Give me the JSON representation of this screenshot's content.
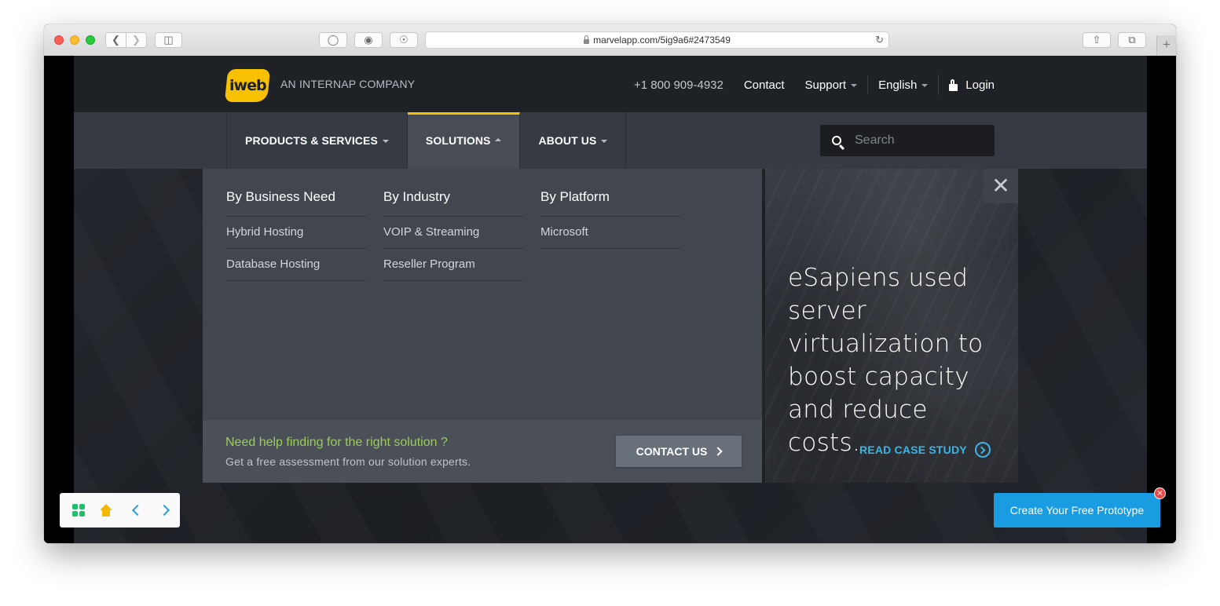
{
  "browser": {
    "url": "marvelapp.com/5ig9a6#2473549"
  },
  "header": {
    "logo_text": "iweb",
    "tagline": "AN INTERNAP COMPANY",
    "phone": "+1 800 909-4932",
    "contact": "Contact",
    "support": "Support",
    "language": "English",
    "login": "Login"
  },
  "nav": {
    "tabs": [
      {
        "label": "PRODUCTS & SERVICES"
      },
      {
        "label": "SOLUTIONS"
      },
      {
        "label": "ABOUT US"
      }
    ],
    "search_placeholder": "Search"
  },
  "mega_menu": {
    "columns": [
      {
        "heading": "By Business Need",
        "links": [
          "Hybrid Hosting",
          "Database Hosting"
        ]
      },
      {
        "heading": "By Industry",
        "links": [
          "VOIP & Streaming",
          "Reseller Program"
        ]
      },
      {
        "heading": "By Platform",
        "links": [
          "Microsoft"
        ]
      }
    ],
    "footer": {
      "title": "Need help finding for the right solution ?",
      "subtitle": "Get a free assessment from our solution experts.",
      "button": "CONTACT US"
    },
    "promo": {
      "headline": "eSapiens used server virtualization to boost capacity and reduce costs.",
      "link": "READ CASE STUDY"
    }
  },
  "marvel": {
    "cta": "Create Your Free Prototype"
  }
}
